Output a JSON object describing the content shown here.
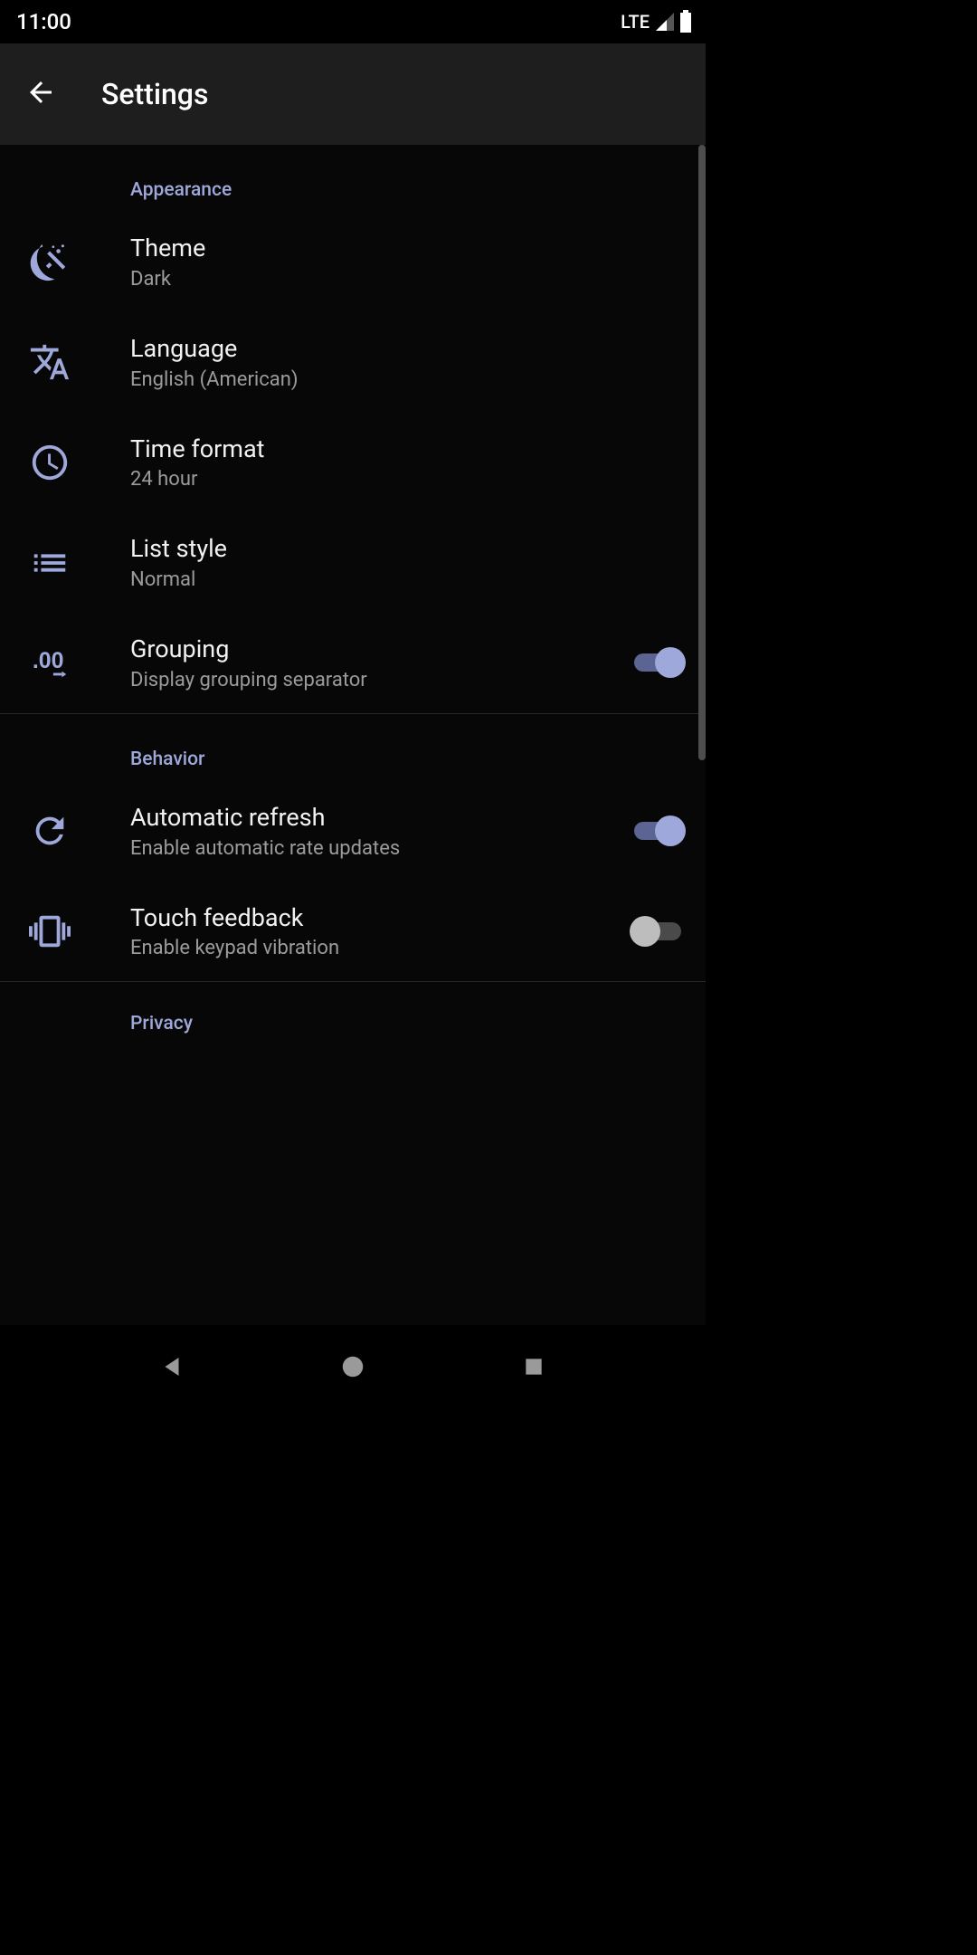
{
  "status": {
    "time": "11:00",
    "network": "LTE"
  },
  "app_bar": {
    "title": "Settings"
  },
  "sections": {
    "appearance": {
      "title": "Appearance",
      "theme": {
        "title": "Theme",
        "summary": "Dark"
      },
      "language": {
        "title": "Language",
        "summary": "English (American)"
      },
      "time_format": {
        "title": "Time format",
        "summary": "24 hour"
      },
      "list_style": {
        "title": "List style",
        "summary": "Normal"
      },
      "grouping": {
        "title": "Grouping",
        "summary": "Display grouping separator",
        "on": true
      }
    },
    "behavior": {
      "title": "Behavior",
      "auto_refresh": {
        "title": "Automatic refresh",
        "summary": "Enable automatic rate updates",
        "on": true
      },
      "touch_feedback": {
        "title": "Touch feedback",
        "summary": "Enable keypad vibration",
        "on": false
      }
    },
    "privacy": {
      "title": "Privacy"
    }
  }
}
